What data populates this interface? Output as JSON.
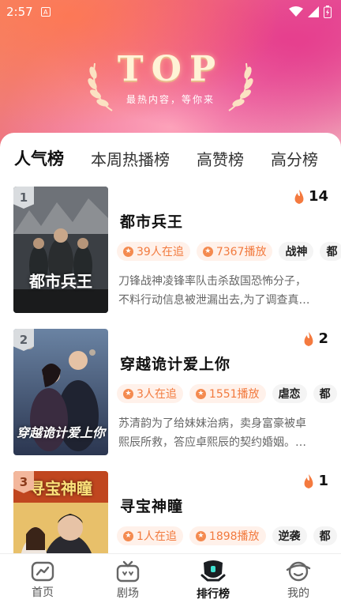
{
  "status": {
    "time": "2:57",
    "app_icon": "A"
  },
  "banner": {
    "title": "TOP",
    "subtitle": "最热内容，等你来"
  },
  "tabs": [
    {
      "label": "人气榜",
      "active": true
    },
    {
      "label": "本周热播榜",
      "active": false
    },
    {
      "label": "高赞榜",
      "active": false
    },
    {
      "label": "高分榜",
      "active": false
    }
  ],
  "items": [
    {
      "rank": "1",
      "title": "都市兵王",
      "heat": "14",
      "followers": "39人在追",
      "plays": "7367播放",
      "genres": [
        "战神",
        "都"
      ],
      "description": "刀锋战神凌锋率队击杀敌国恐怖分子，不料行动信息被泄漏出去,为了调查真…",
      "cover_text": "都市兵王"
    },
    {
      "rank": "2",
      "title": "穿越诡计爱上你",
      "heat": "2",
      "followers": "3人在追",
      "plays": "1551播放",
      "genres": [
        "虐恋",
        "都"
      ],
      "description": "苏清韵为了给妹妹治病，卖身富豪被卓熙辰所救，答应卓熙辰的契约婚姻。…",
      "cover_text": "穿越诡计爱上你"
    },
    {
      "rank": "3",
      "title": "寻宝神瞳",
      "heat": "1",
      "followers": "1人在追",
      "plays": "1898播放",
      "genres": [
        "逆袭",
        "都"
      ],
      "description": "",
      "cover_text": "寻宝神瞳"
    }
  ],
  "nav": [
    {
      "label": "首页",
      "icon": "home-chart-icon"
    },
    {
      "label": "剧场",
      "icon": "tv-icon"
    },
    {
      "label": "排行榜",
      "icon": "ranking-icon",
      "active": true
    },
    {
      "label": "我的",
      "icon": "profile-icon"
    }
  ]
}
